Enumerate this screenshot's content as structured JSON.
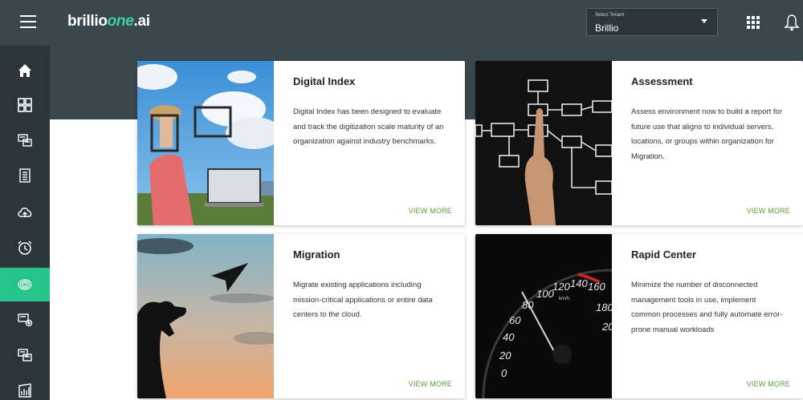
{
  "header": {
    "logo_brand": "brillio",
    "logo_one": "one",
    "logo_ai": ".ai",
    "tenant_label": "Select Tenant",
    "tenant_value": "Brillio"
  },
  "sidebar": {
    "items": [
      {
        "icon": "home-icon"
      },
      {
        "icon": "dashboard-icon"
      },
      {
        "icon": "monitor-icon"
      },
      {
        "icon": "checklist-icon"
      },
      {
        "icon": "cloud-upload-icon"
      },
      {
        "icon": "alarm-clock-icon"
      },
      {
        "icon": "fingerprint-icon",
        "active": true
      },
      {
        "icon": "device-settings-icon"
      },
      {
        "icon": "monitor-icon"
      },
      {
        "icon": "report-chart-icon"
      }
    ]
  },
  "cards": [
    {
      "title": "Digital Index",
      "description": "Digital Index has been designed to evaluate and track the digitization scale maturity of an organization against industry benchmarks.",
      "link": "VIEW MORE"
    },
    {
      "title": "Assessment",
      "description": "Assess environment now to build a report for future use that aligns to individual servers, locations, or groups within organization for Migration.",
      "link": "VIEW MORE"
    },
    {
      "title": "Migration",
      "description": "Migrate existing applications including mission-critical applications or entire data centers to the cloud.",
      "link": "VIEW MORE"
    },
    {
      "title": "Rapid Center",
      "description": "Minimize the number of disconnected management tools in use, implement common processes and fully automate error-prone manual workloads",
      "link": "VIEW MORE"
    }
  ],
  "speedometer": {
    "ticks": [
      "0",
      "20",
      "40",
      "60",
      "80",
      "100",
      "120",
      "140",
      "160",
      "180",
      "20"
    ],
    "unit": "km/h"
  },
  "colors": {
    "topbar": "#3a474d",
    "sidebar": "#2b363b",
    "active": "#25c48a",
    "link": "#5e9c3a"
  }
}
